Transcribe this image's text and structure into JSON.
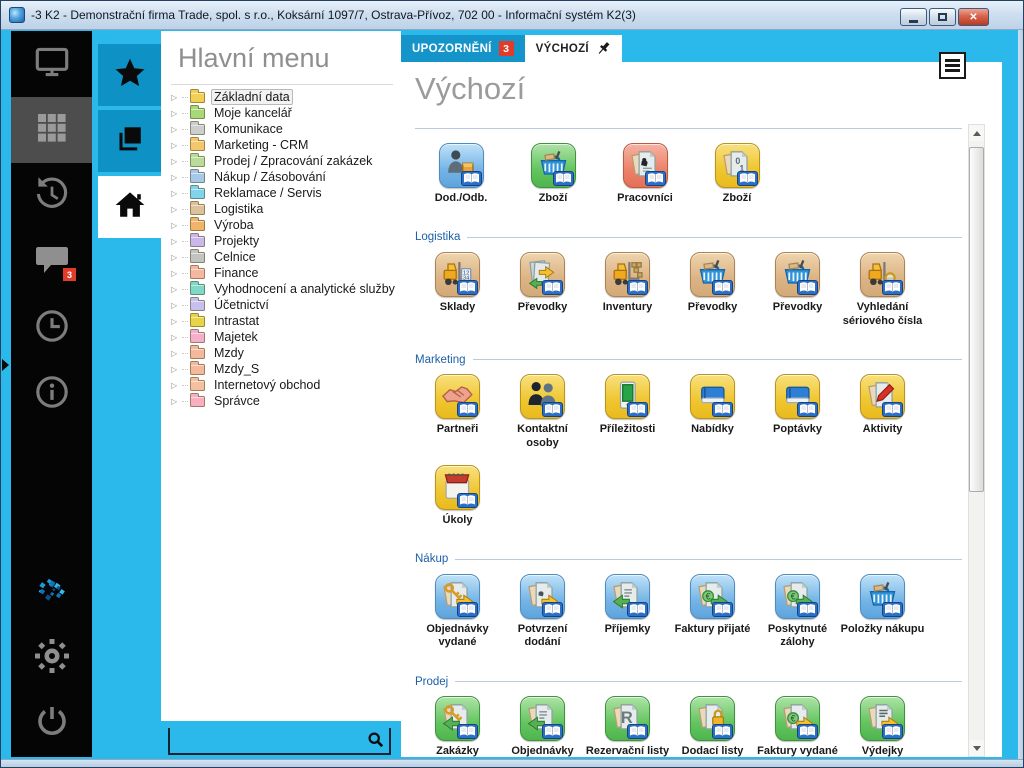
{
  "window": {
    "title": "-3 K2 - Demonstrační firma Trade, spol. s r.o., Koksární 1097/7, Ostrava-Přívoz, 702 00 - Informační systém K2(3)",
    "buttons": {
      "minimize": "minimize",
      "maximize": "maximize",
      "close": "close"
    }
  },
  "colors": {
    "accent_cyan": "#2bb8ea",
    "accent_dark_cyan": "#0e92c6",
    "tab_blue": "#1594ca",
    "badge_red": "#e23b2a",
    "section_label_blue": "#1d5fa7"
  },
  "left_rail": {
    "top_items": [
      {
        "name": "desktop",
        "icon": "monitor",
        "selected": false,
        "badge": ""
      },
      {
        "name": "applications",
        "icon": "grid",
        "selected": true,
        "badge": ""
      },
      {
        "name": "history",
        "icon": "history",
        "selected": false,
        "badge": ""
      },
      {
        "name": "messages",
        "icon": "chat",
        "selected": false,
        "badge": "3"
      },
      {
        "name": "recent",
        "icon": "clock",
        "selected": false,
        "badge": ""
      },
      {
        "name": "info",
        "icon": "info",
        "selected": false,
        "badge": ""
      }
    ],
    "bottom_items": [
      {
        "name": "k2-logo",
        "icon": "k2",
        "selected": false,
        "badge": ""
      },
      {
        "name": "settings",
        "icon": "gear",
        "selected": false,
        "badge": ""
      },
      {
        "name": "power",
        "icon": "power",
        "selected": false,
        "badge": ""
      }
    ]
  },
  "nav_rail": {
    "buttons": [
      {
        "name": "favorites",
        "icon": "star",
        "active": false
      },
      {
        "name": "open-windows",
        "icon": "pages",
        "active": false
      },
      {
        "name": "home",
        "icon": "home",
        "active": true
      }
    ]
  },
  "menu_panel": {
    "title": "Hlavní menu",
    "search_placeholder": "",
    "items": [
      {
        "label": "Základní data",
        "color": "#f3cf53",
        "selected": true
      },
      {
        "label": "Moje kancelář",
        "color": "#a9d878",
        "selected": false
      },
      {
        "label": "Komunikace",
        "color": "#cbcecb",
        "selected": false
      },
      {
        "label": "Marketing - CRM",
        "color": "#f5c66e",
        "selected": false
      },
      {
        "label": "Prodej / Zpracování zakázek",
        "color": "#b9dc9a",
        "selected": false
      },
      {
        "label": "Nákup / Zásobování",
        "color": "#a8c8e8",
        "selected": false
      },
      {
        "label": "Reklamace / Servis",
        "color": "#7fd4ea",
        "selected": false
      },
      {
        "label": "Logistika",
        "color": "#dcc29a",
        "selected": false
      },
      {
        "label": "Výroba",
        "color": "#f0b46a",
        "selected": false
      },
      {
        "label": "Projekty",
        "color": "#cbb8e8",
        "selected": false
      },
      {
        "label": "Celnice",
        "color": "#c2c4c2",
        "selected": false
      },
      {
        "label": "Finance",
        "color": "#f4b8a0",
        "selected": false
      },
      {
        "label": "Vyhodnocení a analytické služby",
        "color": "#7fd8c8",
        "selected": false
      },
      {
        "label": "Účetnictví",
        "color": "#c8c0ec",
        "selected": false
      },
      {
        "label": "Intrastat",
        "color": "#e8d44a",
        "selected": false
      },
      {
        "label": "Majetek",
        "color": "#f4b0c8",
        "selected": false
      },
      {
        "label": "Mzdy",
        "color": "#f4b89c",
        "selected": false
      },
      {
        "label": "Mzdy_S",
        "color": "#f4b89c",
        "selected": false
      },
      {
        "label": "Internetový obchod",
        "color": "#f4c0a0",
        "selected": false
      },
      {
        "label": "Správce",
        "color": "#f8b0c0",
        "selected": false
      }
    ]
  },
  "tabs": [
    {
      "label": "UPOZORNĚNÍ",
      "badge": "3",
      "active": false,
      "pinned": false
    },
    {
      "label": "VÝCHOZÍ",
      "badge": "",
      "active": true,
      "pinned": true
    }
  ],
  "content": {
    "title": "Výchozí",
    "sections": [
      {
        "label": "",
        "cols4": true,
        "items": [
          {
            "label": "Dod./Odb.",
            "tile": "blue",
            "glyph": "person_cart"
          },
          {
            "label": "Zboží",
            "tile": "green",
            "glyph": "basket"
          },
          {
            "label": "Pracovníci",
            "tile": "red",
            "glyph": "docs_photo"
          },
          {
            "label": "Zboží",
            "tile": "yellow",
            "glyph": "docs01"
          }
        ]
      },
      {
        "label": "Logistika",
        "cols4": false,
        "items": [
          {
            "label": "Sklady",
            "tile": "tan",
            "glyph": "forklift_tag"
          },
          {
            "label": "Převodky",
            "tile": "tan",
            "glyph": "docs_arrows"
          },
          {
            "label": "Inventury",
            "tile": "tan",
            "glyph": "forklift_boxes"
          },
          {
            "label": "Převodky",
            "tile": "tan",
            "glyph": "basket"
          },
          {
            "label": "Převodky",
            "tile": "tan",
            "glyph": "basket"
          },
          {
            "label": "Vyhledání sériového čísla",
            "tile": "tan",
            "glyph": "forklift_search"
          }
        ]
      },
      {
        "label": "Marketing",
        "cols4": false,
        "items": [
          {
            "label": "Partneři",
            "tile": "yellow",
            "glyph": "handshake"
          },
          {
            "label": "Kontaktní osoby",
            "tile": "yellow",
            "glyph": "people"
          },
          {
            "label": "Příležitosti",
            "tile": "yellow",
            "glyph": "device"
          },
          {
            "label": "Nabídky",
            "tile": "yellow",
            "glyph": "book"
          },
          {
            "label": "Poptávky",
            "tile": "yellow",
            "glyph": "book"
          },
          {
            "label": "Aktivity",
            "tile": "yellow",
            "glyph": "doc_pen"
          },
          {
            "label": "Úkoly",
            "tile": "yellow",
            "glyph": "calendar"
          }
        ]
      },
      {
        "label": "Nákup",
        "cols4": false,
        "items": [
          {
            "label": "Objednávky vydané",
            "tile": "blue",
            "glyph": "doc_key_out"
          },
          {
            "label": "Potvrzení dodání",
            "tile": "blue",
            "glyph": "doc_out"
          },
          {
            "label": "Příjemky",
            "tile": "blue",
            "glyph": "doc_in"
          },
          {
            "label": "Faktury přijaté",
            "tile": "blue",
            "glyph": "doc_money_in"
          },
          {
            "label": "Poskytnuté zálohy",
            "tile": "blue",
            "glyph": "doc_money_in"
          },
          {
            "label": "Položky nákupu",
            "tile": "blue",
            "glyph": "basket"
          }
        ]
      },
      {
        "label": "Prodej",
        "cols4": false,
        "items": [
          {
            "label": "Zakázky",
            "tile": "green",
            "glyph": "doc_key_in"
          },
          {
            "label": "Objednávky",
            "tile": "green",
            "glyph": "doc_in"
          },
          {
            "label": "Rezervační listy",
            "tile": "green",
            "glyph": "doc_R"
          },
          {
            "label": "Dodací listy",
            "tile": "green",
            "glyph": "doc_lock"
          },
          {
            "label": "Faktury vydané",
            "tile": "green",
            "glyph": "doc_money_out"
          },
          {
            "label": "Výdejky",
            "tile": "green",
            "glyph": "doc_lines_out"
          }
        ]
      }
    ]
  }
}
